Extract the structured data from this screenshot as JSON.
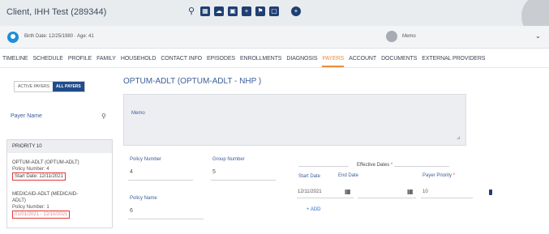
{
  "header": {
    "client_title": "Client, IHH Test (289344)",
    "toolbar_icons": [
      "search-icon",
      "calendar-icon",
      "cloud-icon",
      "folder-icon",
      "plus-square-icon",
      "notification-icon",
      "message-icon",
      "add-circle-icon"
    ]
  },
  "client_bar": {
    "birth_text": "Birth Date: 12/25/1980 · Age: 41",
    "memo_label": "Memo"
  },
  "nav": {
    "tabs": [
      "TIMELINE",
      "SCHEDULE",
      "PROFILE",
      "FAMILY",
      "HOUSEHOLD",
      "CONTACT INFO",
      "EPISODES",
      "ENROLLMENTS",
      "DIAGNOSIS",
      "PAYERS",
      "ACCOUNT",
      "DOCUMENTS",
      "EXTERNAL PROVIDERS"
    ],
    "active": "PAYERS"
  },
  "left_panel": {
    "active_payers_label": "ACTIVE PAYERS",
    "all_payers_label": "ALL PAYERS",
    "payer_name_label": "Payer Name",
    "priority_label": "PRIORITY 10",
    "items": [
      {
        "name": "OPTUM-ADLT (OPTUM-ADLT)",
        "policy": "Policy Number: 4",
        "date": "Start Date: 12/11/2021"
      },
      {
        "name": "MEDICAID-ADLT (MEDICAID-",
        "name2": "ADLT)",
        "policy": "Policy Number: 1",
        "date": "01/01/2021 - 12/10/2021"
      }
    ]
  },
  "detail": {
    "title": "OPTUM-ADLT (OPTUM-ADLT - NHP )",
    "memo_label": "Memo",
    "policy_number_label": "Policy Number",
    "policy_number_value": "4",
    "group_number_label": "Group Number",
    "group_number_value": "5",
    "policy_name_label": "Policy Name",
    "policy_name_value": "6",
    "effective_dates_label": "Effective Dates",
    "start_date_label": "Start Date",
    "start_date_value": "12/11/2021",
    "end_date_label": "End Date",
    "payer_priority_label": "Payer Priority",
    "payer_priority_value": "10",
    "add_label": "+ ADD"
  },
  "colors": {
    "accent": "#e98d3d",
    "primary": "#1f4b8a",
    "link": "#3b5e9a",
    "highlight": "#e23b3b"
  }
}
